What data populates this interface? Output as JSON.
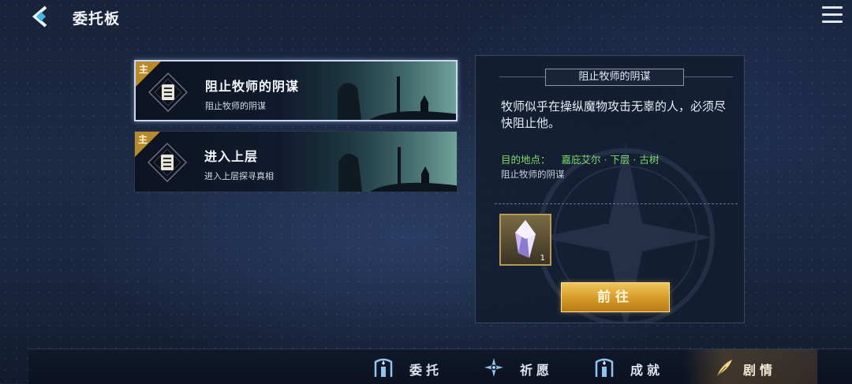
{
  "header": {
    "title": "委托板",
    "back_icon": "back-arrow-icon",
    "menu_icon": "hamburger-menu-icon"
  },
  "quests": [
    {
      "tag": "主",
      "title": "阻止牧师的阴谋",
      "subtitle": "阻止牧师的阴谋",
      "selected": true,
      "icon": "scroll-icon"
    },
    {
      "tag": "主",
      "title": "进入上层",
      "subtitle": "进入上层探寻真相",
      "selected": false,
      "icon": "scroll-icon"
    }
  ],
  "detail": {
    "title": "阻止牧师的阴谋",
    "description": "牧师似乎在操纵魔物攻击无辜的人，必须尽快阻止他。",
    "location_label": "目的地点：",
    "location_value": "嘉庇艾尔 · 下层 · 古树",
    "objective": "阻止牧师的阴谋",
    "reward": {
      "icon": "crystal-icon",
      "count": "1"
    },
    "go_button": "前往"
  },
  "bottom_nav": [
    {
      "label": "委托",
      "icon": "gate-icon",
      "active": false
    },
    {
      "label": "祈愿",
      "icon": "star-compass-icon",
      "active": false
    },
    {
      "label": "成就",
      "icon": "gate-icon",
      "active": false
    },
    {
      "label": "剧情",
      "icon": "quill-icon",
      "active": true
    }
  ],
  "colors": {
    "accent_gold": "#d69a28",
    "location_green": "#7fdc6a",
    "tag_gold": "#b88a2e"
  }
}
